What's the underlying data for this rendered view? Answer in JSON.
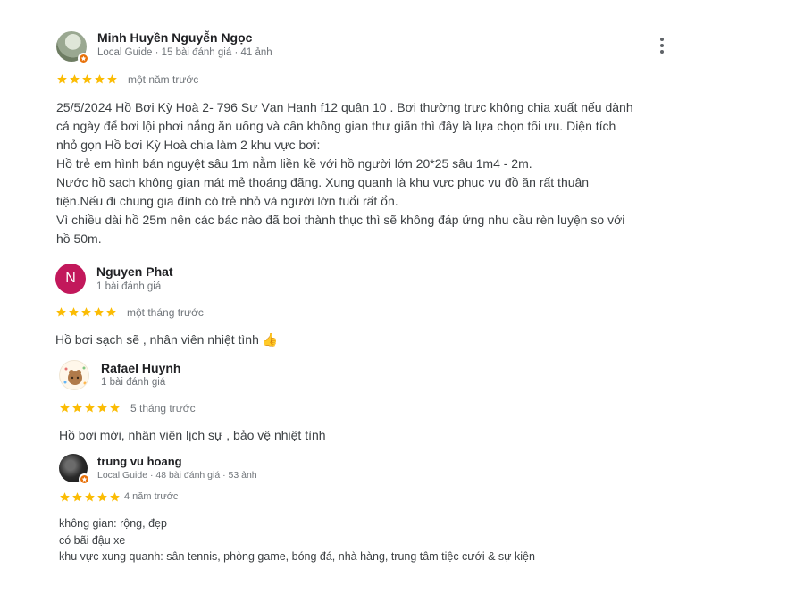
{
  "reviews": [
    {
      "name": "Minh Huyền Nguyễn Ngọc",
      "meta": "Local Guide · 15 bài đánh giá · 41 ảnh",
      "rating": 5,
      "when": "một năm trước",
      "lines": [
        "25/5/2024 Hồ Bơi Kỳ Hoà 2- 796 Sư Vạn Hạnh f12 quận 10 . Bơi thường trực không chia xuất nếu dành",
        "cả ngày để bơi lội phơi nắng ăn uống và cần không gian thư giãn thì đây là lựa chọn tối ưu. Diện tích",
        "nhỏ gọn Hồ bơi Kỳ Hoà chia làm 2 khu vực bơi:",
        "Hồ trẻ em hình bán nguyệt sâu 1m nằm liền kề với hồ người lớn 20*25 sâu 1m4 - 2m.",
        "Nước hồ sạch không gian mát mẻ thoáng đãng. Xung quanh là khu vực phục vụ đồ ăn rất thuận",
        "tiện.Nếu đi chung gia đình có trẻ nhỏ và người lớn tuổi rất ổn.",
        "Vì chiều dài hồ 25m nên các bác nào đã bơi thành thục thì sẽ không đáp ứng nhu cầu rèn luyện so với",
        "hồ 50m."
      ]
    },
    {
      "name": "Nguyen Phat",
      "initial": "N",
      "meta": "1 bài đánh giá",
      "rating": 5,
      "when": "một tháng trước",
      "lines": [
        "Hồ bơi sạch sẽ , nhân viên nhiệt tình 👍"
      ]
    },
    {
      "name": "Rafael Huynh",
      "meta": "1 bài đánh giá",
      "rating": 5,
      "when": "5 tháng trước",
      "lines": [
        "Hồ bơi mới, nhân viên lịch sự , bảo vệ nhiệt tình"
      ]
    },
    {
      "name": "trung vu hoang",
      "meta": "Local Guide · 48 bài đánh giá · 53 ảnh",
      "rating": 5,
      "when": "4 năm trước",
      "lines": [
        "không gian: rộng, đẹp",
        "có bãi đậu xe",
        "khu vực xung quanh: sân tennis, phòng game, bóng đá, nhà hàng, trung tâm tiệc cưới & sự kiện"
      ]
    }
  ],
  "colors": {
    "star": "#fbbc04",
    "avatar_n": "#c2185b",
    "badge": "#e8710a"
  },
  "icons": {
    "more": "more-vert-icon",
    "star": "star-icon",
    "badge": "local-guide-badge-icon"
  }
}
